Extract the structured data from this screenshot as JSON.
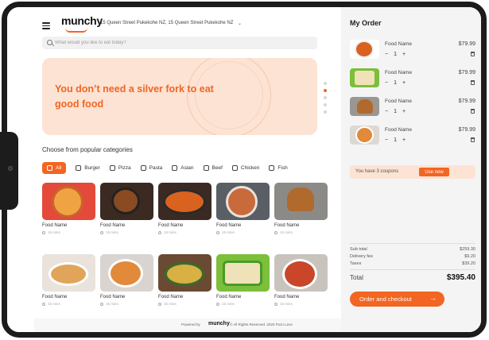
{
  "header": {
    "logo": "munchy",
    "address": "15 Queen Street Pukekohe NZ, 15 Queen Street Pukekohe NZ",
    "address_chevron": "⌄"
  },
  "search": {
    "placeholder": "What would you like to eat today?"
  },
  "banner": {
    "headline": "You don’t need a silver fork to eat good food"
  },
  "categories": {
    "title": "Choose from popular categories",
    "items": [
      {
        "label": "All",
        "icon": "home-icon",
        "active": true
      },
      {
        "label": "Burger",
        "icon": "burger-icon"
      },
      {
        "label": "Pizza",
        "icon": "pizza-icon"
      },
      {
        "label": "Pasta",
        "icon": "pasta-icon"
      },
      {
        "label": "Asian",
        "icon": "bowl-icon"
      },
      {
        "label": "Beef",
        "icon": "beef-icon"
      },
      {
        "label": "Chicken",
        "icon": "chicken-icon"
      },
      {
        "label": "Fish",
        "icon": "fish-icon"
      }
    ]
  },
  "foods": [
    {
      "name": "Food Name",
      "time": "15 mins"
    },
    {
      "name": "Food Name",
      "time": "15 mins"
    },
    {
      "name": "Food Name",
      "time": "15 mins"
    },
    {
      "name": "Food Name",
      "time": "15 mins"
    },
    {
      "name": "Food Name",
      "time": "15 mins"
    },
    {
      "name": "Food Name",
      "time": "15 mins"
    },
    {
      "name": "Food Name",
      "time": "15 mins"
    },
    {
      "name": "Food Name",
      "time": "15 mins"
    },
    {
      "name": "Food Name",
      "time": "15 mins"
    },
    {
      "name": "Food Name",
      "time": "15 mins"
    }
  ],
  "order": {
    "title": "My Order",
    "items": [
      {
        "name": "Food Name",
        "price": "$79.99",
        "minus": "−",
        "qty": "1",
        "plus": "+"
      },
      {
        "name": "Food Name",
        "price": "$79.99",
        "minus": "−",
        "qty": "1",
        "plus": "+"
      },
      {
        "name": "Food Name",
        "price": "$79.99",
        "minus": "−",
        "qty": "1",
        "plus": "+"
      },
      {
        "name": "Food Name",
        "price": "$79.99",
        "minus": "−",
        "qty": "1",
        "plus": "+"
      }
    ],
    "coupon_text": "You have 3 coupons",
    "coupon_button": "Use now",
    "subtotal_label": "Sub total",
    "subtotal": "$259.30",
    "delivery_label": "Delivery fee",
    "delivery": "$9.20",
    "taxes_label": "Taxes",
    "taxes": "$39.20",
    "total_label": "Total",
    "total": "$395.40",
    "checkout_label": "Order and checkout",
    "checkout_arrow": "→"
  },
  "footer": {
    "powered_by": "Powered by",
    "logo": "munchy",
    "copyright": "© All Rights Reserved. 2020 Pozo Lece"
  },
  "colors": {
    "accent": "#f26522",
    "banner_bg": "#fde3d4",
    "sidebar_bg": "#f4f4f5"
  }
}
